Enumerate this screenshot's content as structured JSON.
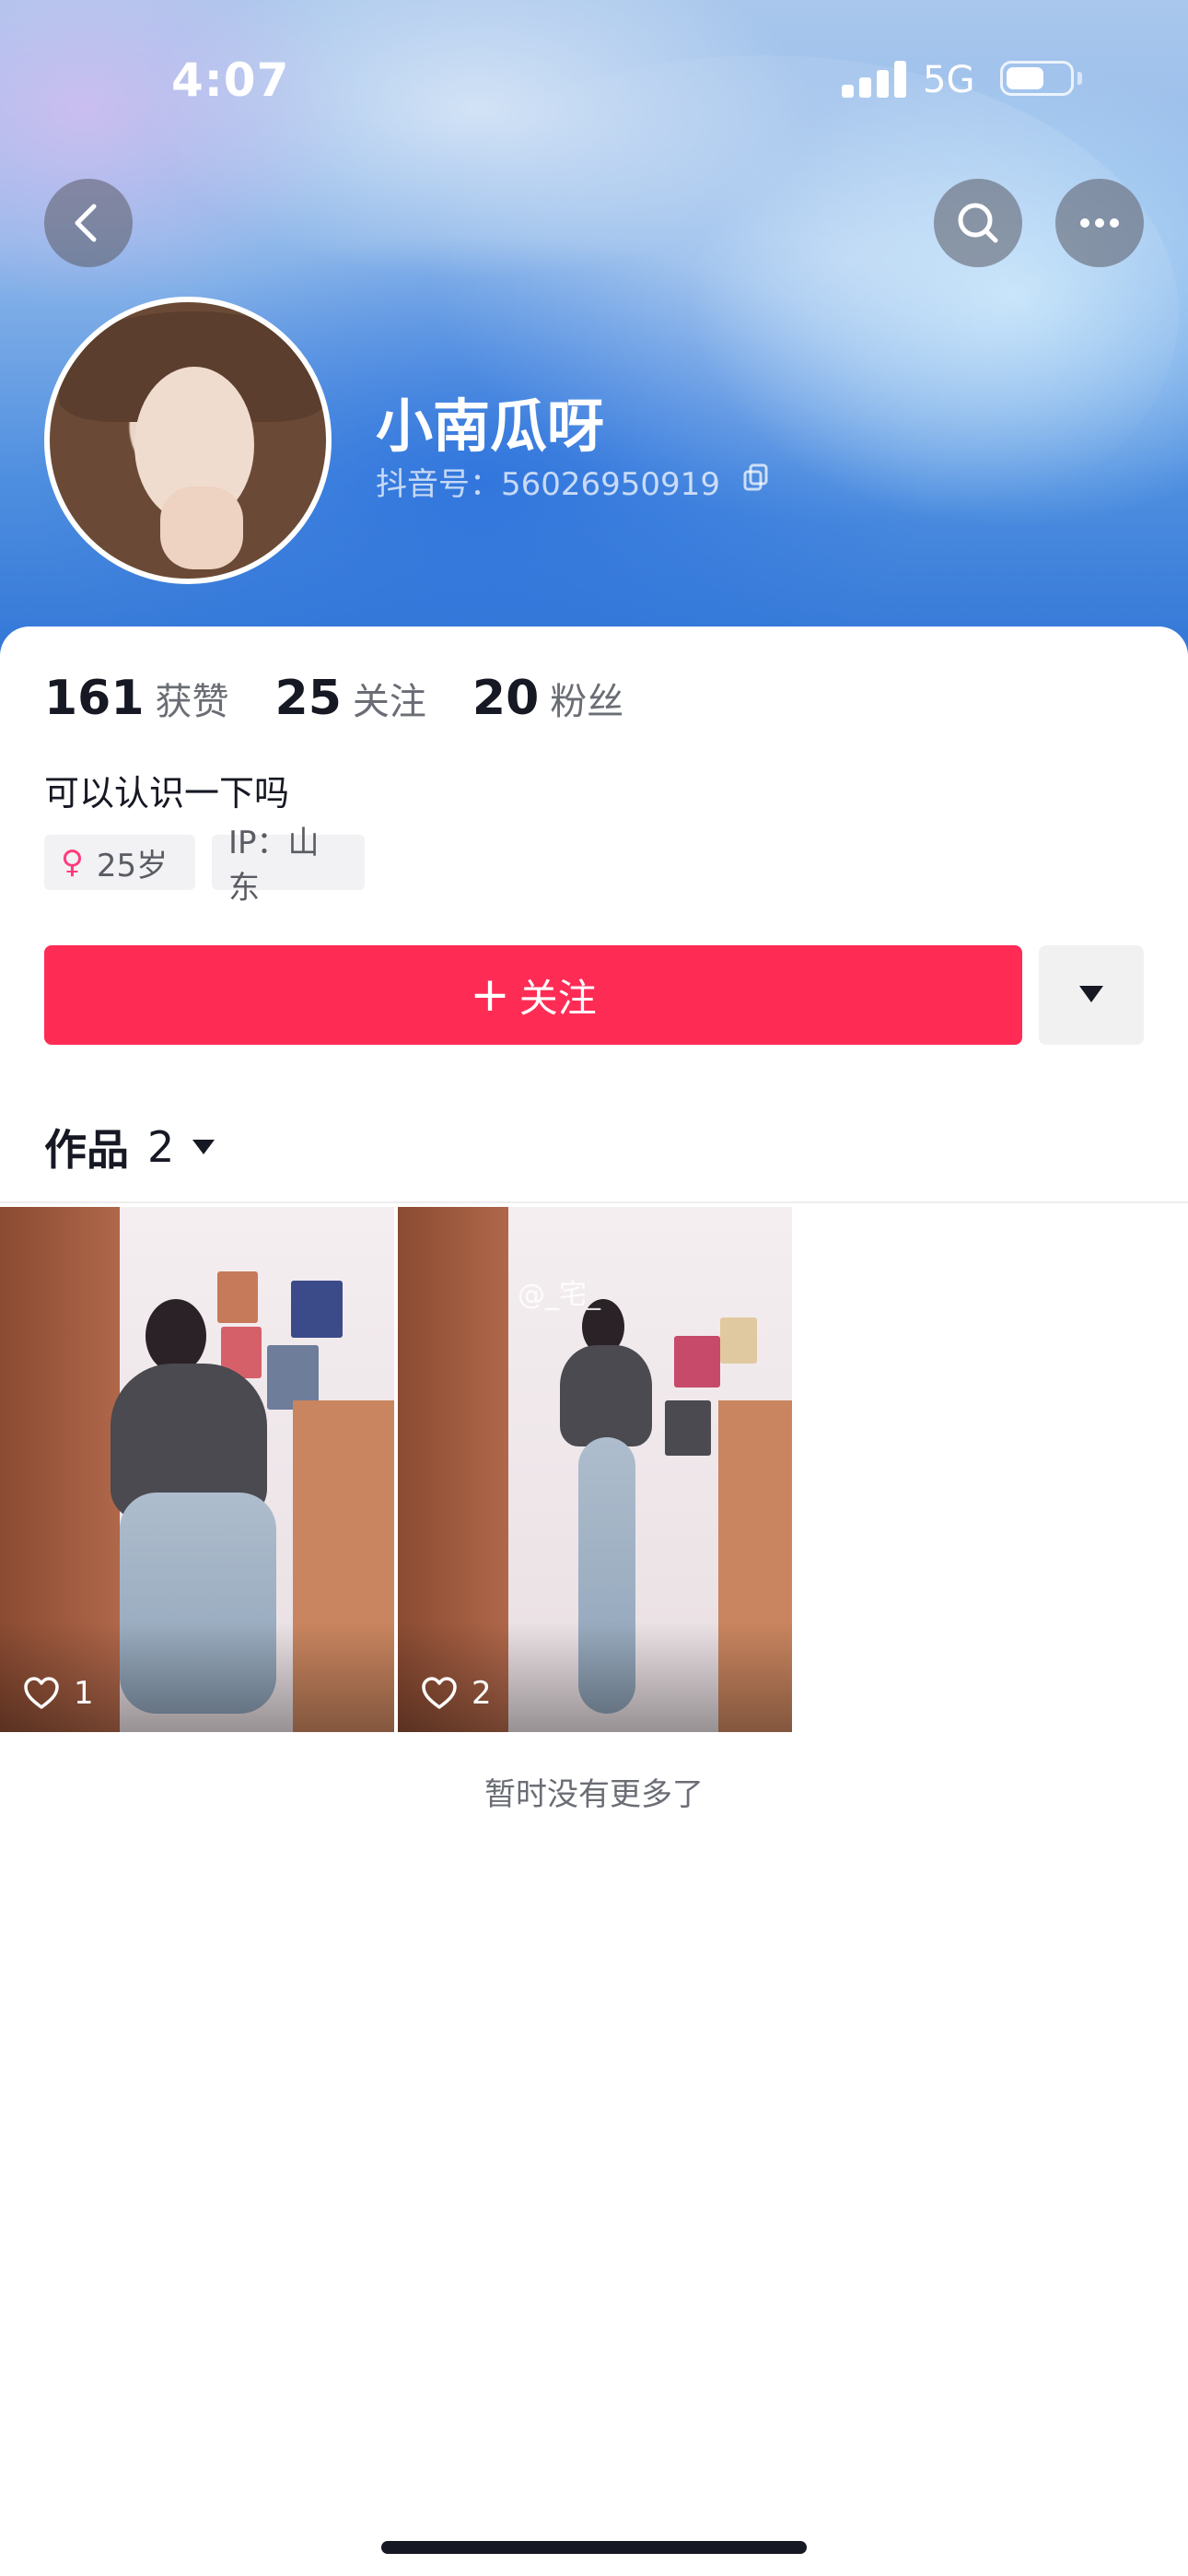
{
  "status_bar": {
    "time": "4:07",
    "network": "5G",
    "battery_icon": "battery-icon",
    "signal_icon": "signal-icon"
  },
  "header": {
    "back_icon": "chevron-left-icon",
    "search_icon": "search-icon",
    "more_icon": "more-horizontal-icon"
  },
  "profile": {
    "name": "小南瓜呀",
    "douyin_id": "抖音号：56026950919",
    "copy_icon": "copy-icon"
  },
  "stats": [
    {
      "value": "161",
      "label": "获赞"
    },
    {
      "value": "25",
      "label": "关注"
    },
    {
      "value": "20",
      "label": "粉丝"
    }
  ],
  "bio": "可以认识一下吗",
  "tags": {
    "age": "25岁",
    "gender_icon": "female-icon",
    "gender_glyph": "♀",
    "ip": "IP：山东"
  },
  "actions": {
    "follow_plus": "+",
    "follow_label": "关注",
    "dropdown_icon": "caret-down-icon"
  },
  "works_tab": {
    "label": "作品",
    "count": "2"
  },
  "videos": [
    {
      "likes": "1"
    },
    {
      "likes": "2",
      "watermark": "@_宅_"
    }
  ],
  "footer_text": "暂时没有更多了",
  "colors": {
    "accent": "#fe2c55",
    "text": "#161823",
    "muted": "#6b6d75"
  }
}
